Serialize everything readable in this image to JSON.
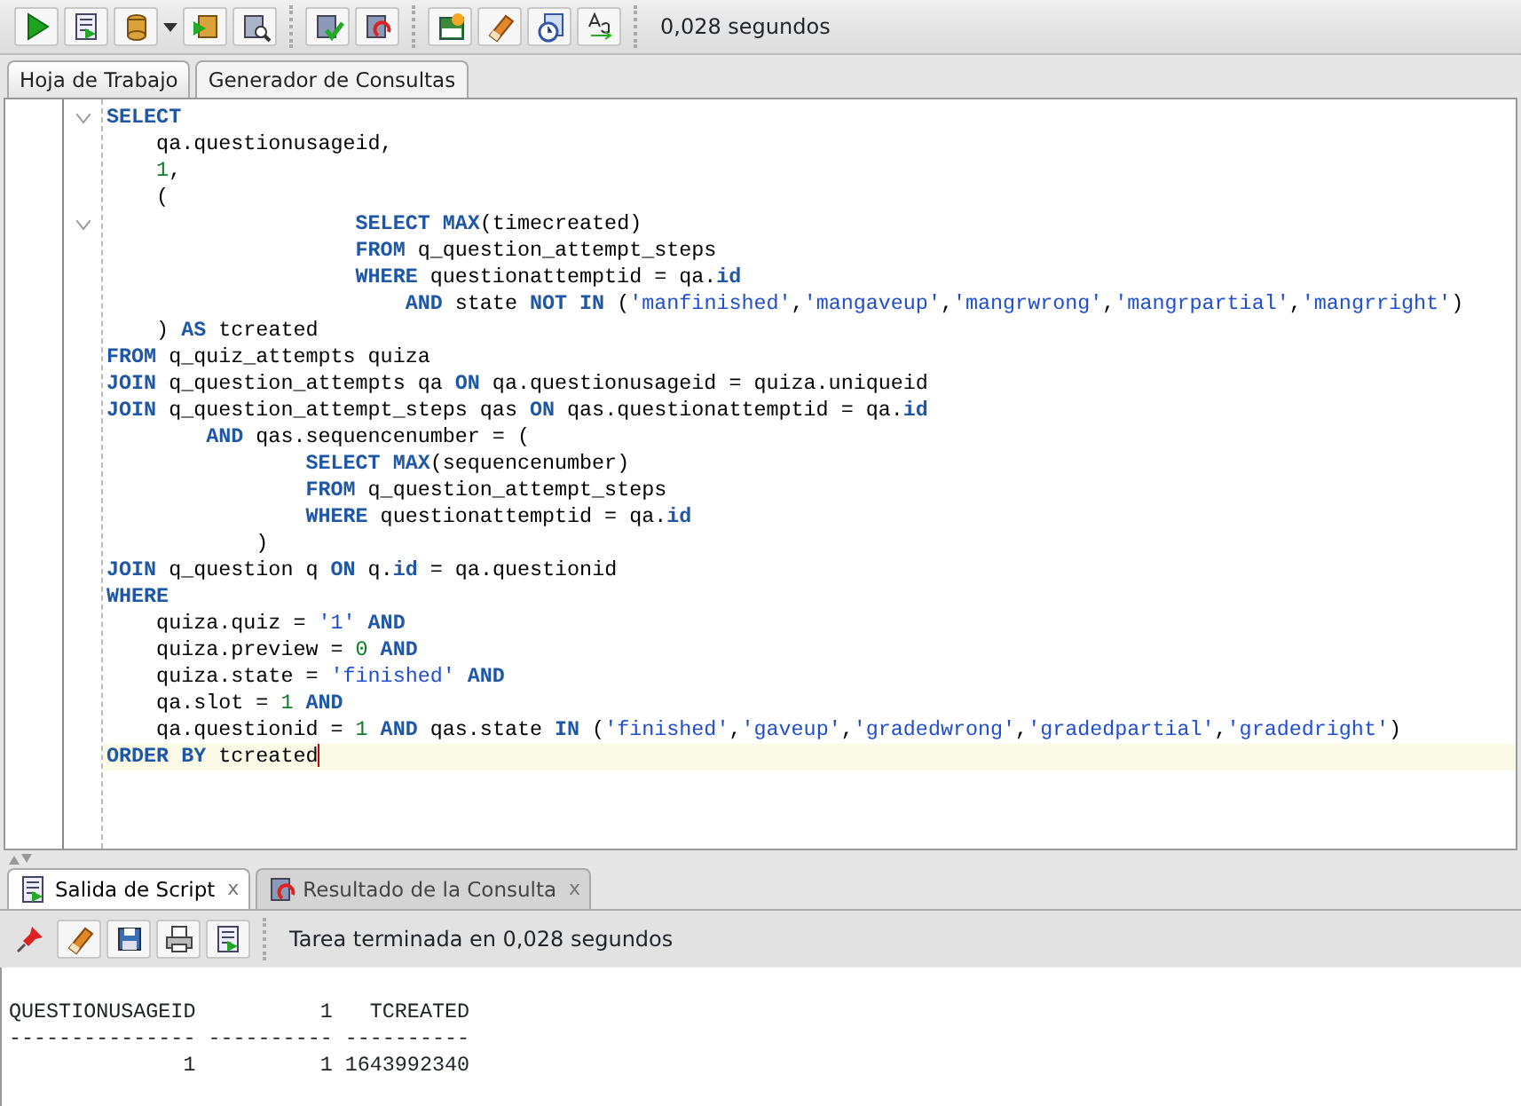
{
  "toolbar": {
    "timing": "0,028 segundos"
  },
  "editor_tabs": [
    {
      "label": "Hoja de Trabajo",
      "selected": true
    },
    {
      "label": "Generador de Consultas",
      "selected": false
    }
  ],
  "code_lines": [
    {
      "fold": true,
      "tokens": [
        {
          "t": "SELECT",
          "kind": "kw"
        }
      ]
    },
    {
      "tokens": [
        {
          "t": "    qa.questionusageid,",
          "kind": "plain"
        }
      ]
    },
    {
      "tokens": [
        {
          "t": "    1",
          "kind": "num"
        },
        {
          "t": ",",
          "kind": "plain"
        }
      ]
    },
    {
      "tokens": [
        {
          "t": "    (",
          "kind": "plain"
        }
      ]
    },
    {
      "fold": true,
      "tokens": [
        {
          "t": "                    SELECT MAX",
          "kind": "kw"
        },
        {
          "t": "(timecreated)",
          "kind": "plain"
        }
      ]
    },
    {
      "tokens": [
        {
          "t": "                    FROM",
          "kind": "kw"
        },
        {
          "t": " q_question_attempt_steps",
          "kind": "plain"
        }
      ]
    },
    {
      "tokens": [
        {
          "t": "                    WHERE",
          "kind": "kw"
        },
        {
          "t": " questionattemptid = qa.",
          "kind": "plain"
        },
        {
          "t": "id",
          "kind": "kw"
        }
      ]
    },
    {
      "tokens": [
        {
          "t": "                        AND",
          "kind": "kw"
        },
        {
          "t": " state ",
          "kind": "plain"
        },
        {
          "t": "NOT IN",
          "kind": "kw"
        },
        {
          "t": " (",
          "kind": "plain"
        },
        {
          "t": "'manfinished'",
          "kind": "str"
        },
        {
          "t": ",",
          "kind": "plain"
        },
        {
          "t": "'mangaveup'",
          "kind": "str"
        },
        {
          "t": ",",
          "kind": "plain"
        },
        {
          "t": "'mangrwrong'",
          "kind": "str"
        },
        {
          "t": ",",
          "kind": "plain"
        },
        {
          "t": "'mangrpartial'",
          "kind": "str"
        },
        {
          "t": ",",
          "kind": "plain"
        },
        {
          "t": "'mangrright'",
          "kind": "str"
        },
        {
          "t": ")",
          "kind": "plain"
        }
      ]
    },
    {
      "tokens": [
        {
          "t": "    ) ",
          "kind": "plain"
        },
        {
          "t": "AS",
          "kind": "kw"
        },
        {
          "t": " tcreated",
          "kind": "plain"
        }
      ]
    },
    {
      "tokens": [
        {
          "t": "FROM",
          "kind": "kw"
        },
        {
          "t": " q_quiz_attempts quiza",
          "kind": "plain"
        }
      ]
    },
    {
      "tokens": [
        {
          "t": "JOIN",
          "kind": "kw"
        },
        {
          "t": " q_question_attempts qa ",
          "kind": "plain"
        },
        {
          "t": "ON",
          "kind": "kw"
        },
        {
          "t": " qa.questionusageid = quiza.uniqueid",
          "kind": "plain"
        }
      ]
    },
    {
      "tokens": [
        {
          "t": "JOIN",
          "kind": "kw"
        },
        {
          "t": " q_question_attempt_steps qas ",
          "kind": "plain"
        },
        {
          "t": "ON",
          "kind": "kw"
        },
        {
          "t": " qas.questionattemptid = qa.",
          "kind": "plain"
        },
        {
          "t": "id",
          "kind": "kw"
        }
      ]
    },
    {
      "tokens": [
        {
          "t": "        AND",
          "kind": "kw"
        },
        {
          "t": " qas.sequencenumber = (",
          "kind": "plain"
        }
      ]
    },
    {
      "tokens": [
        {
          "t": "                SELECT MAX",
          "kind": "kw"
        },
        {
          "t": "(sequencenumber)",
          "kind": "plain"
        }
      ]
    },
    {
      "tokens": [
        {
          "t": "                FROM",
          "kind": "kw"
        },
        {
          "t": " q_question_attempt_steps",
          "kind": "plain"
        }
      ]
    },
    {
      "tokens": [
        {
          "t": "                WHERE",
          "kind": "kw"
        },
        {
          "t": " questionattemptid = qa.",
          "kind": "plain"
        },
        {
          "t": "id",
          "kind": "kw"
        }
      ]
    },
    {
      "tokens": [
        {
          "t": "            )",
          "kind": "plain"
        }
      ]
    },
    {
      "tokens": [
        {
          "t": "JOIN",
          "kind": "kw"
        },
        {
          "t": " q_question q ",
          "kind": "plain"
        },
        {
          "t": "ON",
          "kind": "kw"
        },
        {
          "t": " q.",
          "kind": "plain"
        },
        {
          "t": "id",
          "kind": "kw"
        },
        {
          "t": " = qa.questionid",
          "kind": "plain"
        }
      ]
    },
    {
      "tokens": [
        {
          "t": "WHERE",
          "kind": "kw"
        }
      ]
    },
    {
      "tokens": [
        {
          "t": "    quiza.quiz = ",
          "kind": "plain"
        },
        {
          "t": "'1'",
          "kind": "str"
        },
        {
          "t": " AND",
          "kind": "kw"
        }
      ]
    },
    {
      "tokens": [
        {
          "t": "    quiza.preview = ",
          "kind": "plain"
        },
        {
          "t": "0",
          "kind": "num"
        },
        {
          "t": " AND",
          "kind": "kw"
        }
      ]
    },
    {
      "tokens": [
        {
          "t": "    quiza.state = ",
          "kind": "plain"
        },
        {
          "t": "'finished'",
          "kind": "str"
        },
        {
          "t": " AND",
          "kind": "kw"
        }
      ]
    },
    {
      "tokens": [
        {
          "t": "    qa.slot = ",
          "kind": "plain"
        },
        {
          "t": "1",
          "kind": "num"
        },
        {
          "t": " AND",
          "kind": "kw"
        }
      ]
    },
    {
      "tokens": [
        {
          "t": "    qa.questionid = ",
          "kind": "plain"
        },
        {
          "t": "1",
          "kind": "num"
        },
        {
          "t": " AND",
          "kind": "kw"
        },
        {
          "t": " qas.state ",
          "kind": "plain"
        },
        {
          "t": "IN",
          "kind": "kw"
        },
        {
          "t": " (",
          "kind": "plain"
        },
        {
          "t": "'finished'",
          "kind": "str"
        },
        {
          "t": ",",
          "kind": "plain"
        },
        {
          "t": "'gaveup'",
          "kind": "str"
        },
        {
          "t": ",",
          "kind": "plain"
        },
        {
          "t": "'gradedwrong'",
          "kind": "str"
        },
        {
          "t": ",",
          "kind": "plain"
        },
        {
          "t": "'gradedpartial'",
          "kind": "str"
        },
        {
          "t": ",",
          "kind": "plain"
        },
        {
          "t": "'gradedright'",
          "kind": "str"
        },
        {
          "t": ")",
          "kind": "plain"
        }
      ]
    },
    {
      "current": true,
      "tokens": [
        {
          "t": "ORDER BY",
          "kind": "kw"
        },
        {
          "t": " tcreated",
          "kind": "plain"
        }
      ]
    }
  ],
  "output_tabs": [
    {
      "label": "Salida de Script",
      "close": "x",
      "selected": true
    },
    {
      "label": "Resultado de la Consulta",
      "close": "x",
      "selected": false
    }
  ],
  "output_status": "Tarea terminada en 0,028 segundos",
  "output_lines": [
    "QUESTIONUSAGEID          1   TCREATED",
    "--------------- ---------- ----------",
    "              1          1 1643992340"
  ]
}
